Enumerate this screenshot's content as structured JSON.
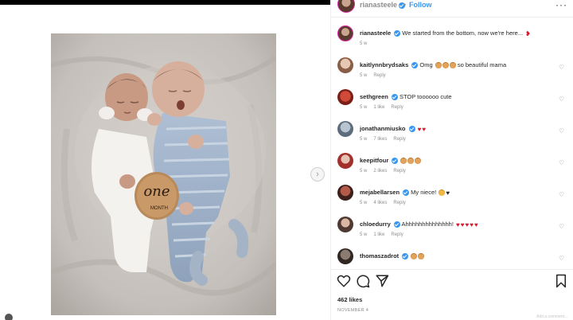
{
  "header": {
    "username": "rianasteele",
    "separator": "•",
    "follow_label": "Follow",
    "more_label": "···"
  },
  "caption": {
    "username": "rianasteele",
    "text": "We started from the bottom, now we're here...",
    "time": "5 w"
  },
  "comments": [
    {
      "username": "kaitlynnbrydsaks",
      "text": "Omg",
      "suffix": "so beautiful mama",
      "emoji": [
        "face",
        "face",
        "face"
      ],
      "time": "5 w",
      "likes": "",
      "reply": "Reply"
    },
    {
      "username": "sethgreen",
      "text": "STOP toooooo cute",
      "suffix": "",
      "emoji": [],
      "time": "5 w",
      "likes": "1 like",
      "reply": "Reply"
    },
    {
      "username": "jonathanmiusko",
      "text": "",
      "suffix": "",
      "emoji": [
        "heart",
        "heart"
      ],
      "time": "5 w",
      "likes": "7 likes",
      "reply": "Reply"
    },
    {
      "username": "keepitfour",
      "text": "",
      "suffix": "",
      "emoji": [
        "face",
        "face",
        "face"
      ],
      "time": "5 w",
      "likes": "2 likes",
      "reply": "Reply"
    },
    {
      "username": "mejabellarsen",
      "text": "My niece!",
      "suffix": "",
      "emoji": [
        "cat",
        "heart"
      ],
      "time": "5 w",
      "likes": "4 likes",
      "reply": "Reply"
    },
    {
      "username": "chloedurry",
      "text": "Ahhhhhhhhhhhhhh!",
      "suffix": "",
      "emoji": [
        "heart",
        "heart",
        "heart",
        "heart",
        "heart"
      ],
      "time": "5 w",
      "likes": "1 like",
      "reply": "Reply"
    },
    {
      "username": "thomaszadrot",
      "text": "",
      "suffix": "",
      "emoji": [
        "face",
        "face"
      ],
      "time": "",
      "likes": "",
      "reply": ""
    }
  ],
  "actions": {
    "like_icon": "heart-outline-icon",
    "comment_icon": "comment-icon",
    "share_icon": "paper-plane-icon",
    "save_icon": "bookmark-icon"
  },
  "likes_text": "462 likes",
  "posted_text": "NOVEMBER 4",
  "add_comment_hint": "Add a comment...",
  "photo": {
    "sign_word": "one",
    "sign_sub": "MONTH"
  },
  "colors": {
    "link_blue": "#3897f0",
    "verified_blue": "#3897f0",
    "heart_red": "#d41c2c",
    "muted_gray": "#8e8e8e"
  }
}
